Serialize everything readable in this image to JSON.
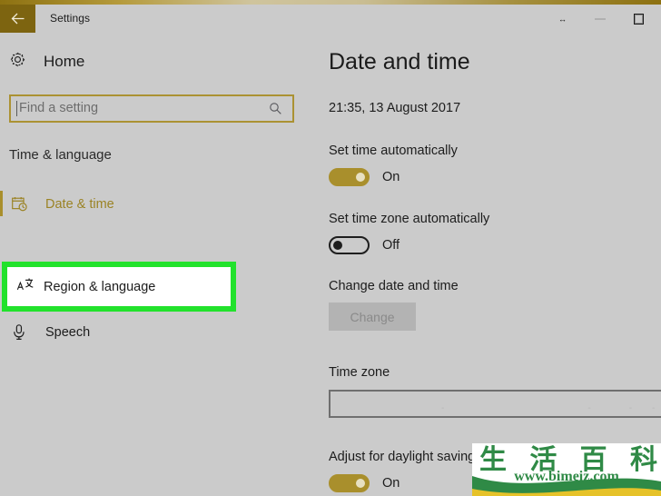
{
  "window": {
    "title": "Settings",
    "back_icon": "back-arrow-icon",
    "controls": {
      "restore_glyph": "↔",
      "minimize_label": "minimize",
      "maximize_label": "maximize"
    }
  },
  "sidebar": {
    "home": {
      "label": "Home",
      "icon": "gear-icon"
    },
    "search": {
      "placeholder": "Find a setting",
      "value": "",
      "icon": "search-icon"
    },
    "section_header": "Time & language",
    "items": [
      {
        "label": "Date & time",
        "icon": "calendar-clock-icon",
        "selected": true
      },
      {
        "label": "Region & language",
        "icon": "language-icon",
        "selected": false,
        "highlighted": true
      },
      {
        "label": "Speech",
        "icon": "microphone-icon",
        "selected": false
      }
    ]
  },
  "main": {
    "title": "Date and time",
    "current_datetime": "21:35, 13 August 2017",
    "settings": [
      {
        "label": "Set time automatically",
        "toggle": "on",
        "state_label": "On"
      },
      {
        "label": "Set time zone automatically",
        "toggle": "off",
        "state_label": "Off"
      }
    ],
    "change_section": {
      "label": "Change date and time",
      "button_label": "Change",
      "button_disabled": true
    },
    "timezone": {
      "label": "Time zone",
      "value": "",
      "marks": [
        "-",
        "-",
        "-",
        "-"
      ]
    },
    "daylight": {
      "label": "Adjust for daylight saving time automatically",
      "toggle": "on",
      "state_label": "On"
    }
  },
  "watermark": {
    "characters": [
      "生",
      "活",
      "百",
      "科"
    ],
    "url": "www.bimeiz.com"
  },
  "colors": {
    "accent_gold": "#a98f2c",
    "titlebar_gold": "#7d6410",
    "highlight_green": "#22e22c",
    "page_bg": "#cbcbcb",
    "watermark_green": "#2f8a46",
    "watermark_yellow": "#e6c229"
  }
}
